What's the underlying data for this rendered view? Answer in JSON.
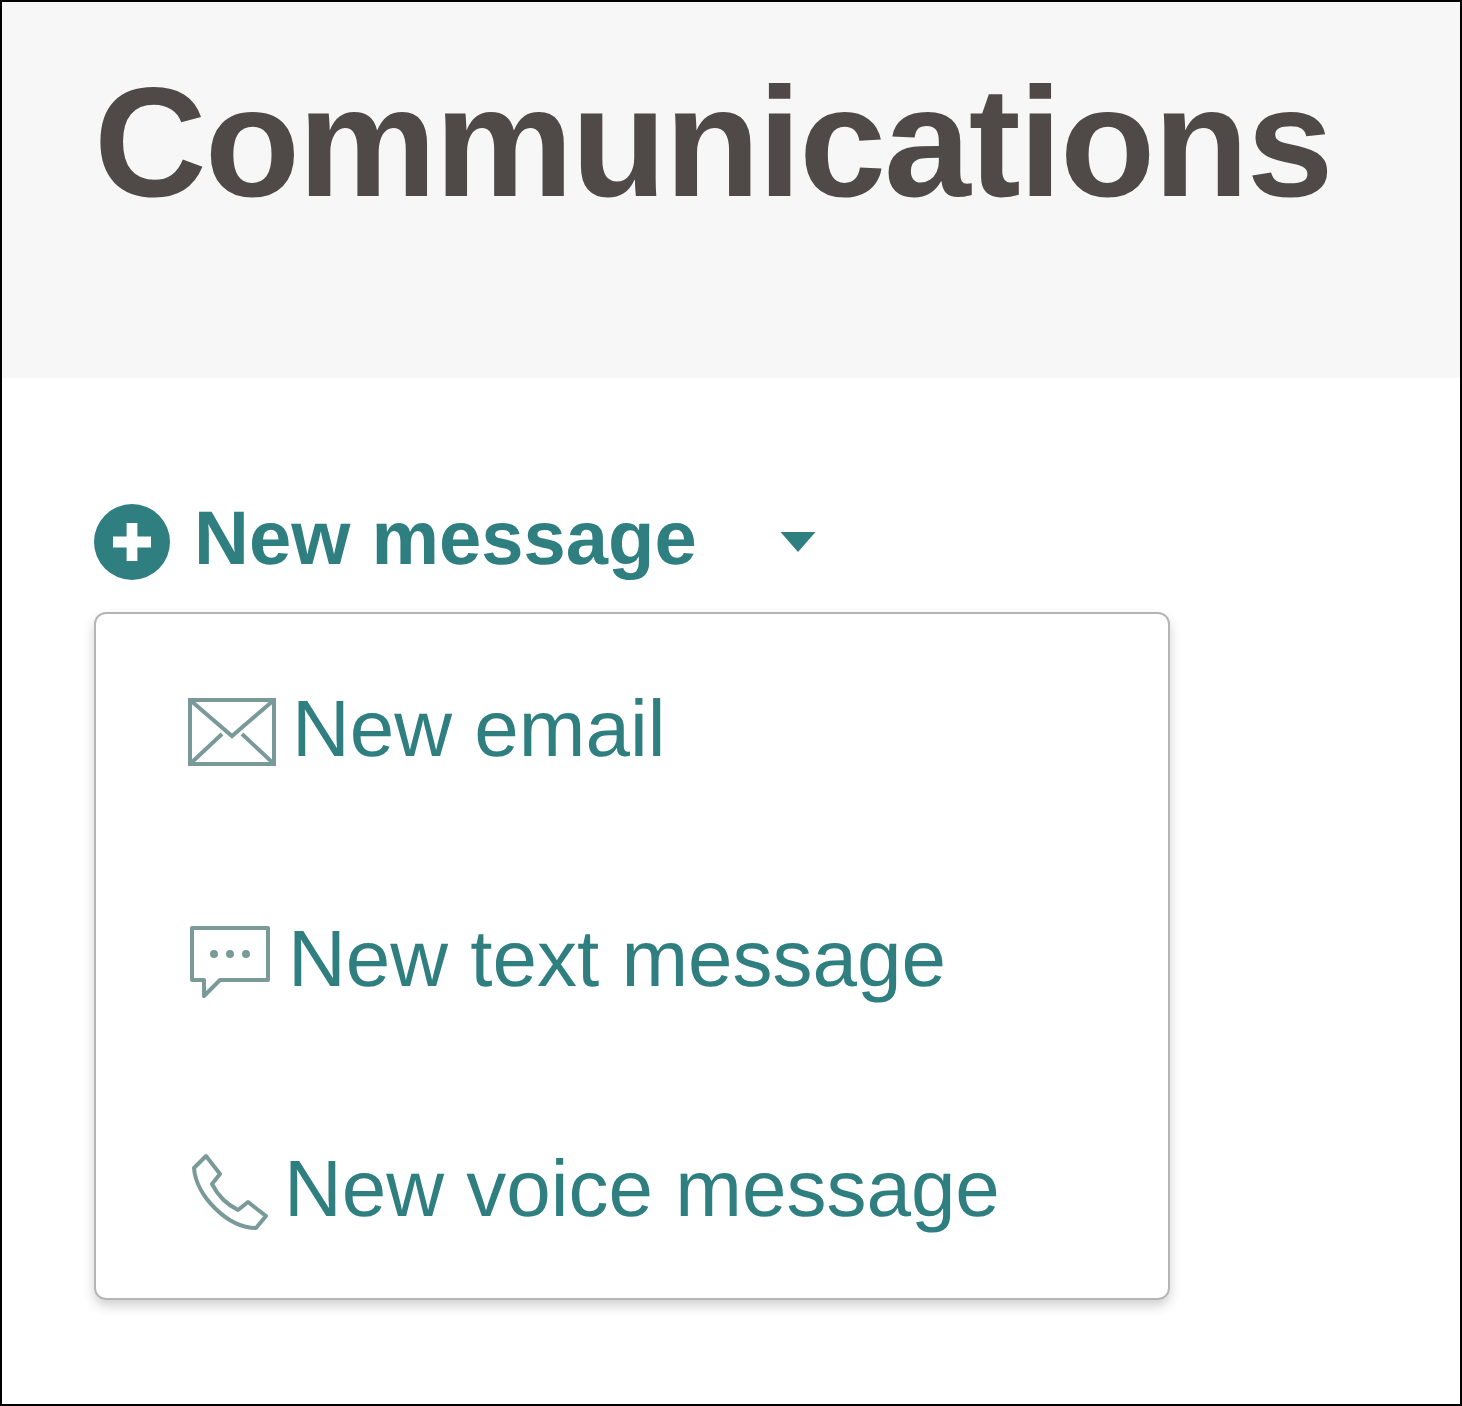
{
  "header": {
    "title": "Communications"
  },
  "new_message": {
    "label": "New message",
    "expanded": true,
    "menu": [
      {
        "kind": "email",
        "label": "New email"
      },
      {
        "kind": "text",
        "label": "New text message"
      },
      {
        "kind": "voice",
        "label": "New voice message"
      }
    ]
  }
}
